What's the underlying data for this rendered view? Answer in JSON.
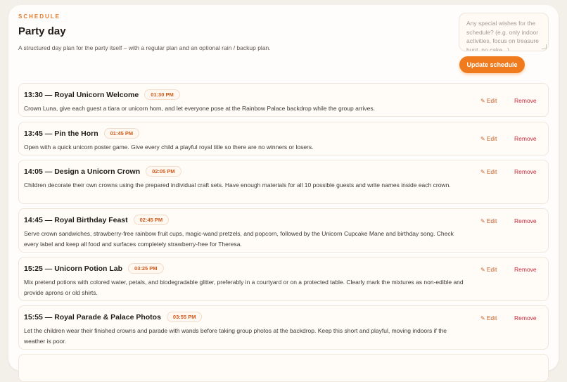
{
  "header": {
    "eyebrow": "SCHEDULE",
    "title": "Party day",
    "subtitle": "A structured day plan for the party itself – with a regular plan and an optional rain / backup plan."
  },
  "wishes": {
    "placeholder": "Any special wishes for the schedule? (e.g. only indoor activities, focus on treasure hunt, no cake...)"
  },
  "update_button": "Update schedule",
  "actions": {
    "edit": "Edit",
    "remove": "Remove",
    "edit_icon": "pencil-icon"
  },
  "items": [
    {
      "title": "13:30 — Royal Unicorn Welcome",
      "time": "01:30 PM",
      "desc": "Crown Luna, give each guest a tiara or unicorn horn, and let everyone pose at the Rainbow Palace backdrop while the group arrives."
    },
    {
      "title": "13:45 — Pin the Horn",
      "time": "01:45 PM",
      "desc": "Open with a quick unicorn poster game. Give every child a playful royal title so there are no winners or losers."
    },
    {
      "title": "14:05 — Design a Unicorn Crown",
      "time": "02:05 PM",
      "desc": "Children decorate their own crowns using the prepared individual craft sets. Have enough materials for all 10 possible guests and write names inside each crown."
    },
    {
      "title": "14:45 — Royal Birthday Feast",
      "time": "02:45 PM",
      "desc": "Serve crown sandwiches, strawberry-free rainbow fruit cups, magic-wand pretzels, and popcorn, followed by the Unicorn Cupcake Mane and birthday song. Check every label and keep all food and surfaces completely strawberry-free for Theresa."
    },
    {
      "title": "15:25 — Unicorn Potion Lab",
      "time": "03:25 PM",
      "desc": "Mix pretend potions with colored water, petals, and biodegradable glitter, preferably in a courtyard or on a protected table. Clearly mark the mixtures as non-edible and provide aprons or old shirts."
    },
    {
      "title": "15:55 — Royal Parade & Palace Photos",
      "time": "03:55 PM",
      "desc": "Let the children wear their finished crowns and parade with wands before taking group photos at the backdrop. Keep this short and playful, moving indoors if the weather is poor."
    },
    {
      "title": "",
      "time": "",
      "desc": ""
    }
  ]
}
